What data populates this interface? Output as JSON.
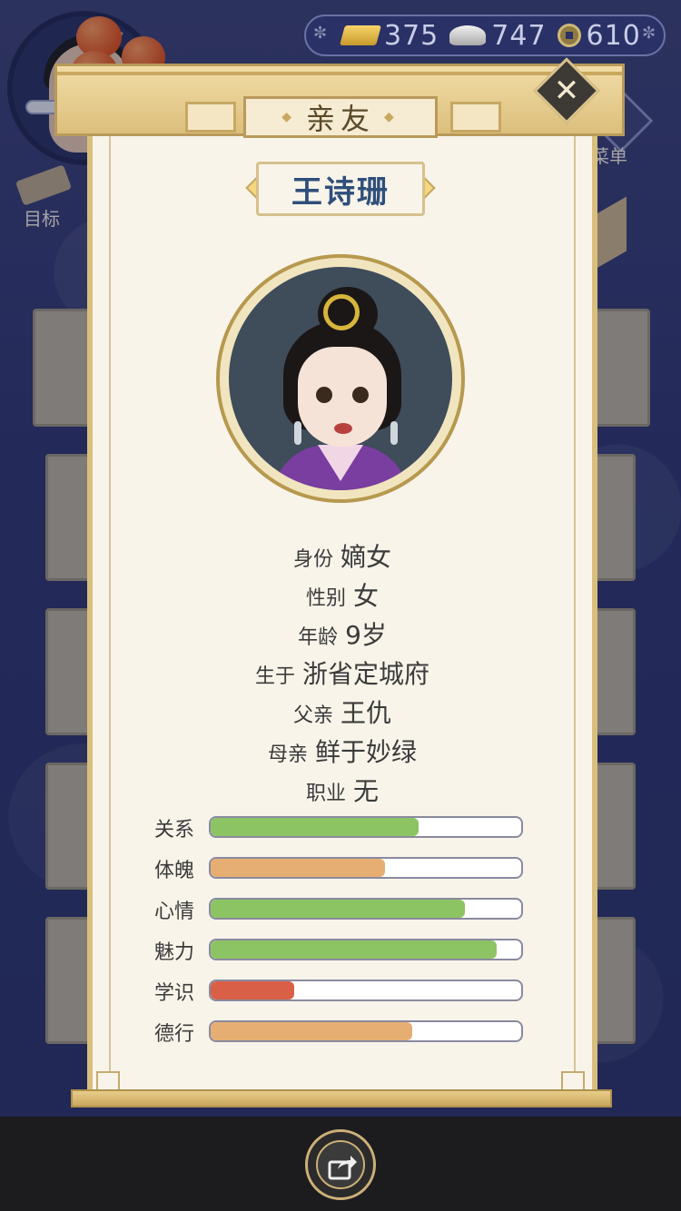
{
  "currency": {
    "gold": "375",
    "silver": "747",
    "coins": "610"
  },
  "hud": {
    "goal_label": "目标",
    "menu_label": "菜单"
  },
  "dialog": {
    "title": "亲友",
    "name": "王诗珊",
    "info": [
      {
        "key": "身份",
        "value": "嫡女"
      },
      {
        "key": "性别",
        "value": "女"
      },
      {
        "key": "年龄",
        "value": "9岁"
      },
      {
        "key": "生于",
        "value": "浙省定城府"
      },
      {
        "key": "父亲",
        "value": "王仇"
      },
      {
        "key": "母亲",
        "value": "鲜于妙绿"
      },
      {
        "key": "职业",
        "value": "无"
      }
    ],
    "stats": [
      {
        "label": "关系",
        "fraction": 0.67,
        "color": "#8cc464"
      },
      {
        "label": "体魄",
        "fraction": 0.56,
        "color": "#e6ae72"
      },
      {
        "label": "心情",
        "fraction": 0.82,
        "color": "#8cc464"
      },
      {
        "label": "魅力",
        "fraction": 0.92,
        "color": "#8cc464"
      },
      {
        "label": "学识",
        "fraction": 0.27,
        "color": "#d95f46"
      },
      {
        "label": "德行",
        "fraction": 0.65,
        "color": "#e6ae72"
      }
    ]
  },
  "icons": {
    "close": "close-icon",
    "share": "share-icon",
    "gold": "gold-ingot-icon",
    "silver": "silver-ingot-icon",
    "coin": "copper-coin-icon"
  }
}
